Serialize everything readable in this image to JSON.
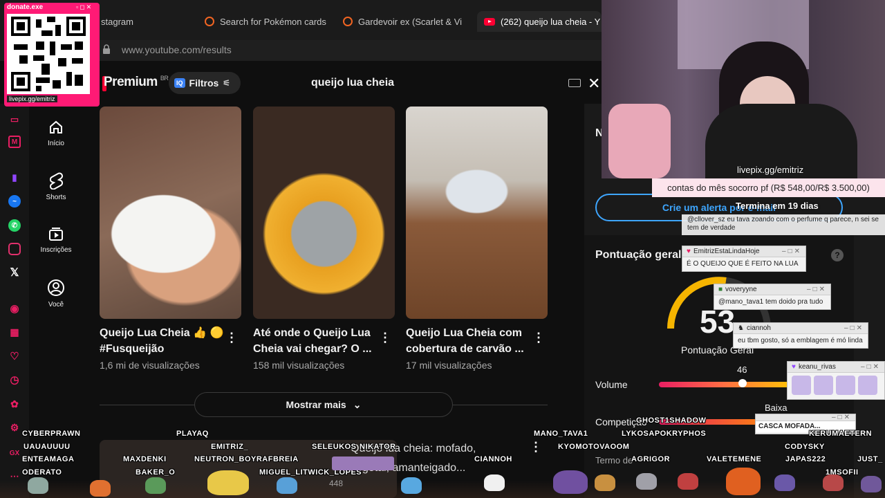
{
  "browser": {
    "tabs": [
      {
        "label": "stagram"
      },
      {
        "label": "Search for Pokémon cards"
      },
      {
        "label": "Gardevoir ex (Scarlet & Vi"
      },
      {
        "label": "(262) queijo lua cheia - Y"
      }
    ],
    "url": "www.youtube.com/results"
  },
  "youtube": {
    "premium": "Premium",
    "region": "BR",
    "filters_label": "Filtros",
    "filters_badge": "IQ",
    "search_value": "queijo lua cheia",
    "nav": [
      {
        "label": "Início",
        "icon": "home-icon"
      },
      {
        "label": "Shorts",
        "icon": "shorts-icon"
      },
      {
        "label": "Inscrições",
        "icon": "subscriptions-icon"
      },
      {
        "label": "Você",
        "icon": "user-icon"
      }
    ],
    "videos": [
      {
        "title": "Queijo Lua Cheia 👍 🟡 #Fusqueijão",
        "views": "1,6 mi de visualizações"
      },
      {
        "title": "Até onde o Queijo Lua Cheia vai chegar? O ...",
        "views": "158 mil visualizações"
      },
      {
        "title": "Queijo Lua Cheia com cobertura de carvão ...",
        "views": "17 mil visualizações"
      }
    ],
    "show_more": "Mostrar mais",
    "row2_title": "Queijo lua cheia: mofado,",
    "row2_sub": "vegetal, amanteigado...",
    "row2_views": "448"
  },
  "panel": {
    "alert_button": "Crie um alerta por e-mail",
    "score_title": "Pontuação geral",
    "score_value": "53",
    "score_label": "Pontuação Geral",
    "volume_label": "Volume",
    "volume_value": "46",
    "competition_label": "Competição",
    "competition_value": "Baixa",
    "term_label": "Termo de",
    "truncated_letter": "N"
  },
  "stream": {
    "cam_url": "livepix.gg/emitriz",
    "goal": "contas do mês socorro pf (R$ 548,00/R$ 3.500,00)",
    "goal_time": "Termina em 19 dias",
    "donate_title": "donate.exe",
    "donate_url": "livepix.gg/emitriz",
    "chat": [
      {
        "user": "",
        "msg": "@cllover_sz eu tava zoando com o perfume q parece, n sei se tem de verdade"
      },
      {
        "user": "EmitrizEstaLindaHoje",
        "msg": "É O QUEIJO QUE É FEITO NA LUA"
      },
      {
        "user": "voveryyne",
        "msg": "@mano_tava1 tem doido pra tudo"
      },
      {
        "user": "ciannoh",
        "msg": "eu tbm gosto, só a emblagem é mó linda"
      },
      {
        "user": "keanu_rivas",
        "msg": ""
      },
      {
        "user": "",
        "msg": "CASCA MOFADA..."
      }
    ],
    "names": [
      "CYBERPRAWN",
      "UAUAUUUU",
      "ENTEAMAGA",
      "ODERATO",
      "PLAYAQ",
      "EMITRIZ_",
      "MAXDENKI",
      "NEUTRON_BOYRAFBREIA",
      "BAKER_O",
      "SELEUKOS",
      "NIKATOR",
      "MIGUEL_LITWICK_LOPES",
      "CIANNOH",
      "MANO_TAVA1",
      "KYOMOTOVAOOM",
      "GHOST1SHADOW",
      "LYKOSAPOKRYPHOS",
      "AGRIGOR",
      "VALETEMENE",
      "CODYSKY",
      "JAPAS222",
      "KERUMAETERN",
      "JUST_",
      "1MSOFII"
    ]
  },
  "colors": {
    "accent_red": "#ff0033",
    "link_blue": "#3ea6ff",
    "donate_pink": "#ff1a75"
  }
}
